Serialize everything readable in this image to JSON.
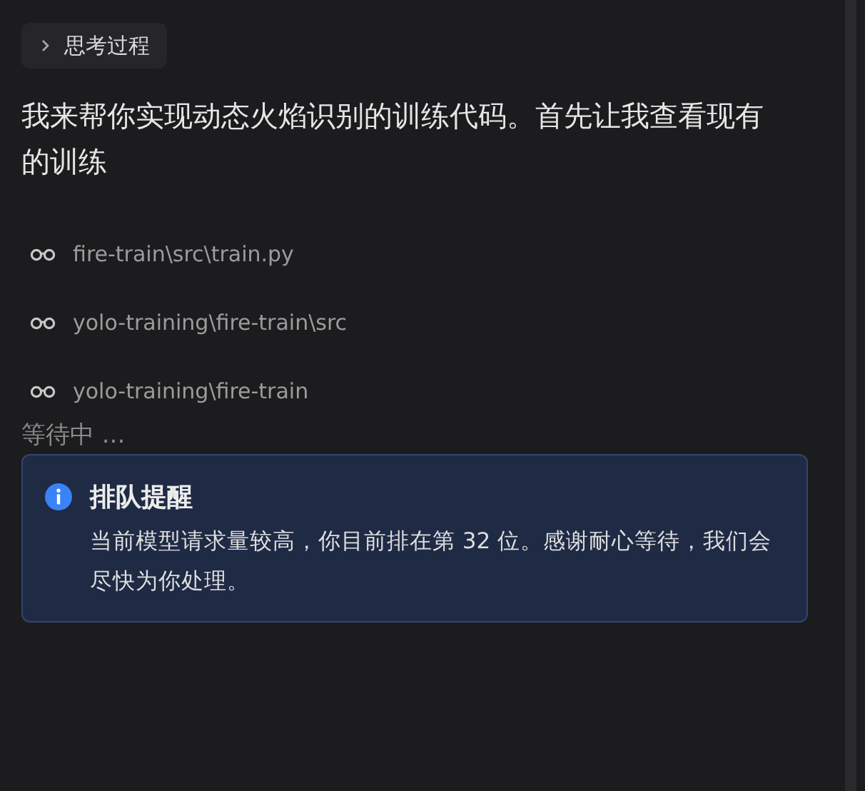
{
  "thinking_toggle": {
    "label": "思考过程",
    "expanded": false
  },
  "message": "我来帮你实现动态火焰识别的训练代码。首先让我查看现有的训练",
  "tool_calls": [
    {
      "path": "fire-train\\src\\train.py"
    },
    {
      "path": "yolo-training\\fire-train\\src"
    },
    {
      "path": "yolo-training\\fire-train"
    }
  ],
  "status": "等待中 ...",
  "notice": {
    "title": "排队提醒",
    "text": "当前模型请求量较高，你目前排在第 32 位。感谢耐心等待，我们会尽快为你处理。"
  }
}
